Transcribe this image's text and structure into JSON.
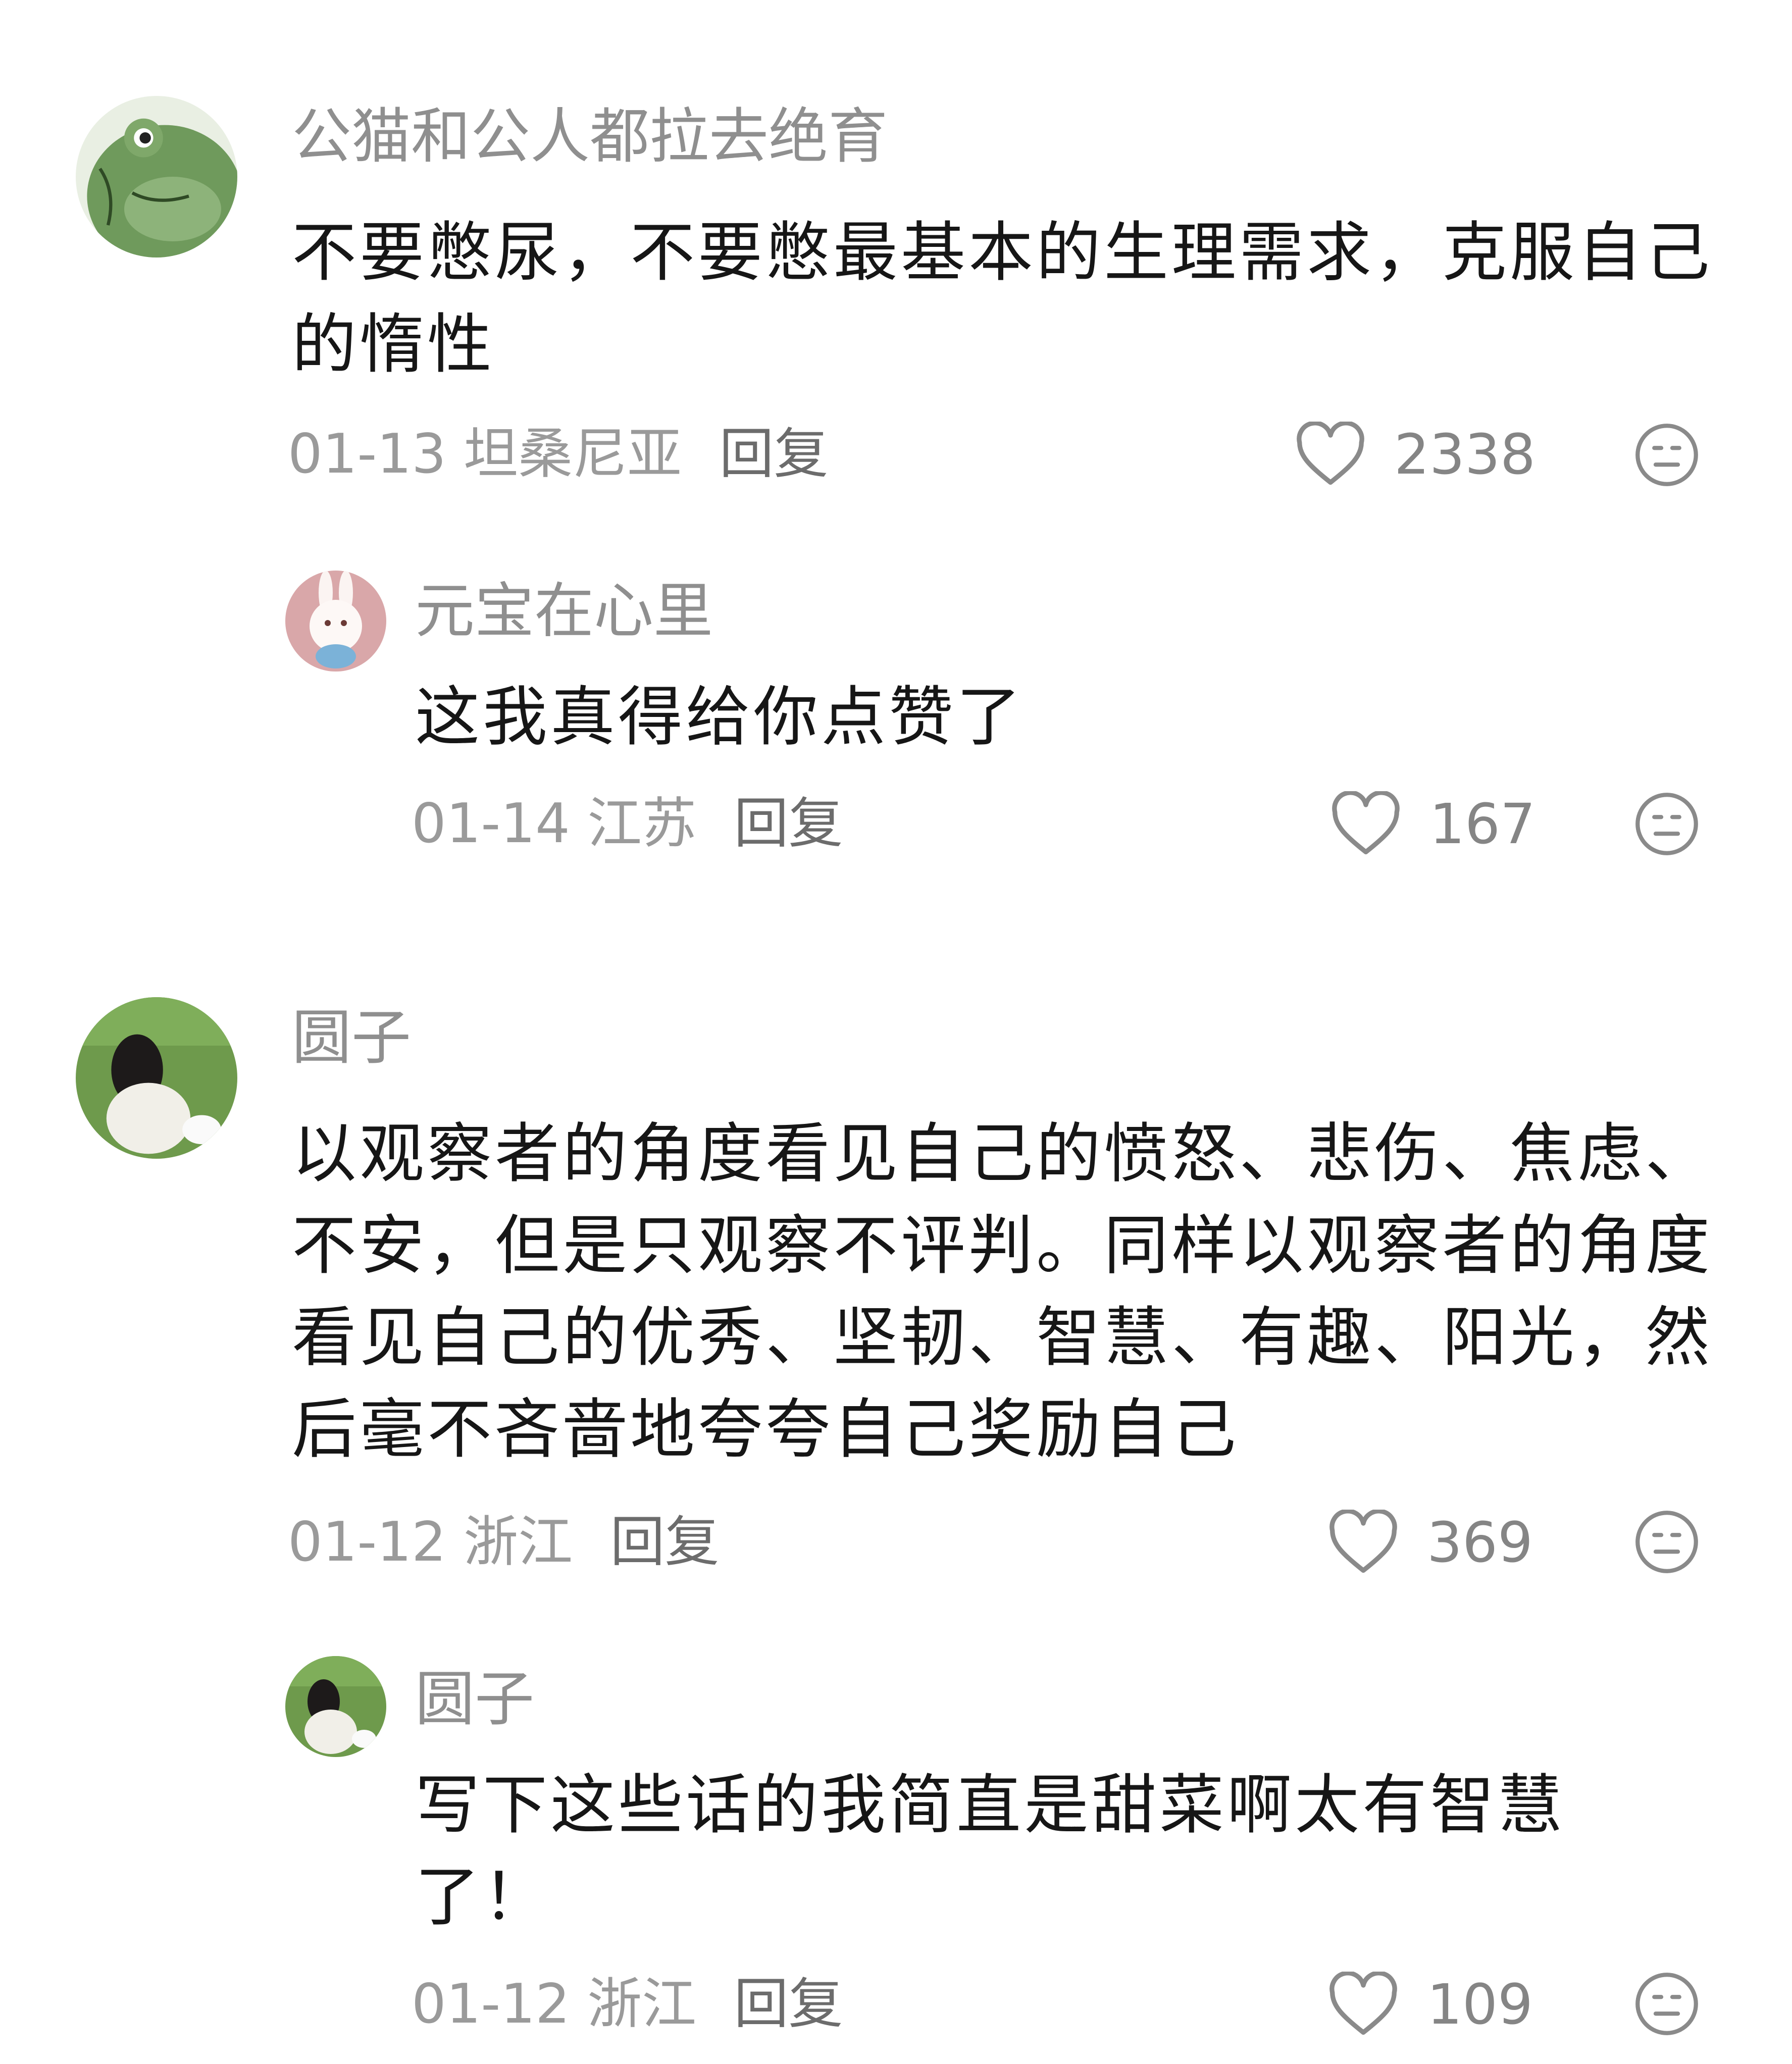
{
  "comments": [
    {
      "username": "公猫和公人都拉去绝育",
      "text": "不要憋尿，不要憋最基本的生理需求，克服自己的惰性",
      "date": "01-13",
      "location": "坦桑尼亚",
      "reply": "回复",
      "likes": "2338",
      "avatar": "frog-avatar"
    },
    {
      "username": "元宝在心里",
      "text": "这我真得给你点赞了",
      "date": "01-14",
      "location": "江苏",
      "reply": "回复",
      "likes": "167",
      "avatar": "bunny-avatar"
    },
    {
      "username": "圆子",
      "text": "以观察者的角度看见自己的愤怒、悲伤、焦虑、不安，但是只观察不评判。同样以观察者的角度看见自己的优秀、坚韧、智慧、有趣、阳光，然后毫不吝啬地夸夸自己奖励自己",
      "date": "01-12",
      "location": "浙江",
      "reply": "回复",
      "likes": "369",
      "avatar": "girl-on-grass-avatar"
    },
    {
      "username": "圆子",
      "text": "写下这些话的我简直是甜菜啊太有智慧了！",
      "date": "01-12",
      "location": "浙江",
      "reply": "回复",
      "likes": "109",
      "avatar": "girl-on-grass-avatar"
    }
  ],
  "icons": {
    "like": "heart-outline-icon",
    "dislike": "neutral-face-icon"
  },
  "colors": {
    "username": "#8f8f8f",
    "text": "#161616",
    "meta": "#9a9a9a",
    "icon": "#8a8a8a"
  }
}
